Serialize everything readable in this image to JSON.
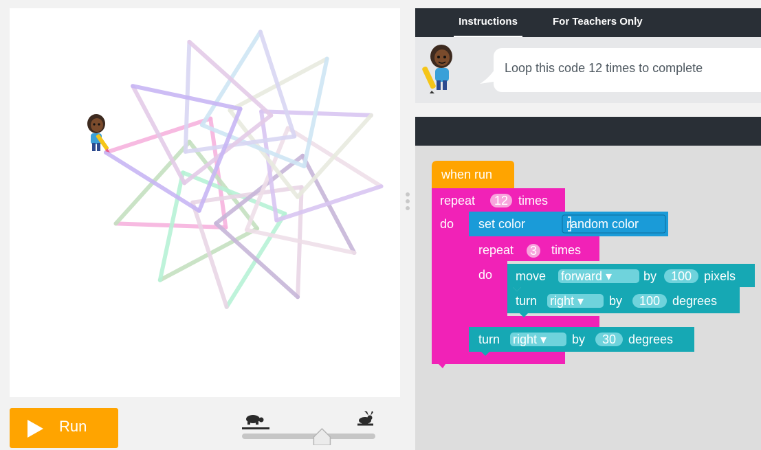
{
  "tabs": {
    "instructions": "Instructions",
    "teachers": "For Teachers Only"
  },
  "instructions": {
    "text": "Loop this code 12 times to complete"
  },
  "run_button": {
    "label": "Run"
  },
  "speed_slider": {
    "value": 0.6
  },
  "blocks": {
    "when_run": "when run",
    "outer_repeat": {
      "label": "repeat",
      "count": "12",
      "suffix": "times",
      "do": "do"
    },
    "set_color": {
      "label": "set color",
      "value": "random color"
    },
    "inner_repeat": {
      "label": "repeat",
      "count": "3",
      "suffix": "times",
      "do": "do"
    },
    "move": {
      "label": "move",
      "direction": "forward ▾",
      "by": "by",
      "amount": "100",
      "unit": "pixels"
    },
    "turn_inner": {
      "label": "turn",
      "direction": "right ▾",
      "by": "by",
      "amount": "100",
      "unit": "degrees"
    },
    "turn_outer": {
      "label": "turn",
      "direction": "right ▾",
      "by": "by",
      "amount": "30",
      "unit": "degrees"
    }
  },
  "colors": {
    "orange": "#ffa400",
    "pink": "#f122b7",
    "blue": "#1a9bd8",
    "teal": "#16a8b4",
    "dark": "#292f36"
  }
}
